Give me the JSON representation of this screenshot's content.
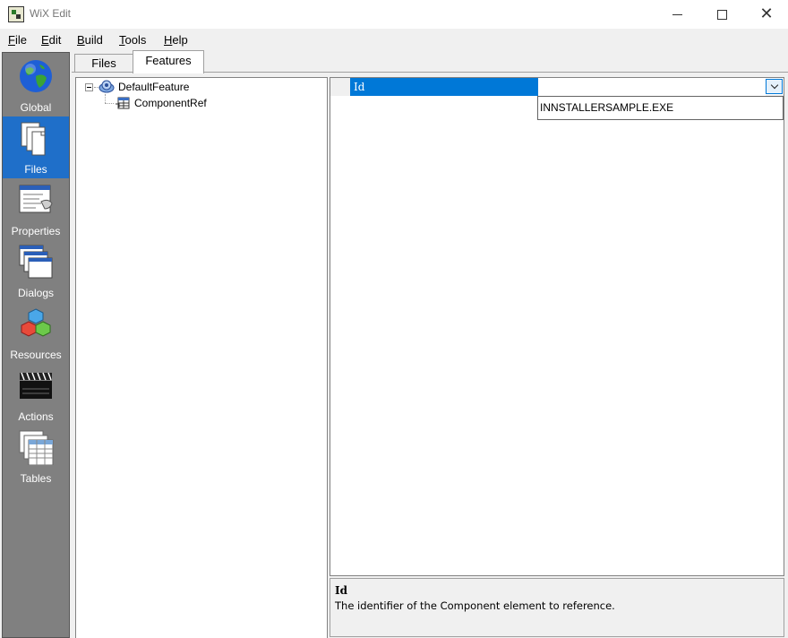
{
  "window": {
    "title": "WiX Edit",
    "controls": {
      "minimize_icon": "minimize-icon",
      "maximize_icon": "maximize-icon",
      "close_icon": "close-icon"
    }
  },
  "menu": [
    {
      "label": "File",
      "accel": "F",
      "rest": "ile"
    },
    {
      "label": "Edit",
      "accel": "E",
      "rest": "dit"
    },
    {
      "label": "Build",
      "accel": "B",
      "rest": "uild"
    },
    {
      "label": "Tools",
      "accel": "T",
      "rest": "ools"
    },
    {
      "label": "Help",
      "accel": "H",
      "rest": "elp"
    }
  ],
  "sidebar": {
    "items": [
      {
        "label": "Global",
        "icon": "globe-icon",
        "active": false
      },
      {
        "label": "Files",
        "icon": "files-icon",
        "active": true
      },
      {
        "label": "Properties",
        "icon": "properties-icon",
        "active": false
      },
      {
        "label": "Dialogs",
        "icon": "dialogs-icon",
        "active": false
      },
      {
        "label": "Resources",
        "icon": "resources-icon",
        "active": false
      },
      {
        "label": "Actions",
        "icon": "actions-icon",
        "active": false
      },
      {
        "label": "Tables",
        "icon": "tables-icon",
        "active": false
      }
    ]
  },
  "tabs": [
    {
      "label": "Files",
      "active": false
    },
    {
      "label": "Features",
      "active": true
    }
  ],
  "tree": {
    "root": {
      "label": "DefaultFeature",
      "icon": "feature-icon",
      "expanded": true
    },
    "child": {
      "label": "ComponentRef",
      "icon": "component-ref-icon"
    }
  },
  "property_grid": {
    "rows": [
      {
        "name": "Id",
        "value": ""
      }
    ],
    "dropdown_options": [
      "INNSTALLERSAMPLE.EXE"
    ]
  },
  "description": {
    "title": "Id",
    "text": "The identifier of the Component element to reference."
  },
  "colors": {
    "accent": "#0078d7",
    "sidebar_bg": "#808080",
    "sidebar_active": "#1f6fc9"
  }
}
